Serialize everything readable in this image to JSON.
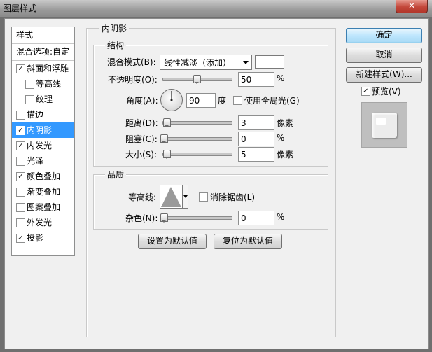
{
  "window": {
    "title": "图层样式",
    "close_glyph": "✕"
  },
  "styles_panel": {
    "header": "样式",
    "blend_options": "混合选项:自定",
    "items": [
      {
        "label": "斜面和浮雕",
        "checked": true,
        "sub": false
      },
      {
        "label": "等高线",
        "checked": false,
        "sub": true
      },
      {
        "label": "纹理",
        "checked": false,
        "sub": true
      },
      {
        "label": "描边",
        "checked": false,
        "sub": false
      },
      {
        "label": "内阴影",
        "checked": true,
        "sub": false,
        "selected": true
      },
      {
        "label": "内发光",
        "checked": true,
        "sub": false
      },
      {
        "label": "光泽",
        "checked": false,
        "sub": false
      },
      {
        "label": "颜色叠加",
        "checked": true,
        "sub": false
      },
      {
        "label": "渐变叠加",
        "checked": false,
        "sub": false
      },
      {
        "label": "图案叠加",
        "checked": false,
        "sub": false
      },
      {
        "label": "外发光",
        "checked": false,
        "sub": false
      },
      {
        "label": "投影",
        "checked": true,
        "sub": false
      }
    ]
  },
  "inner_shadow": {
    "title": "内阴影",
    "structure": {
      "title": "结构",
      "blend_mode_label": "混合模式(B):",
      "blend_mode_value": "线性减淡（添加）",
      "color": "#ffffff",
      "opacity_label": "不透明度(O):",
      "opacity_value": "50",
      "opacity_pct": 50,
      "opacity_unit": "%",
      "angle_label": "角度(A):",
      "angle_value": "90",
      "angle_unit": "度",
      "global_light_label": "使用全局光(G)",
      "global_light_checked": false,
      "distance_label": "距离(D):",
      "distance_value": "3",
      "distance_unit": "像素",
      "choke_label": "阻塞(C):",
      "choke_value": "0",
      "choke_unit": "%",
      "size_label": "大小(S):",
      "size_value": "5",
      "size_unit": "像素"
    },
    "quality": {
      "title": "品质",
      "contour_label": "等高线:",
      "anti_alias_label": "消除锯齿(L)",
      "anti_alias_checked": false,
      "noise_label": "杂色(N):",
      "noise_value": "0",
      "noise_unit": "%"
    },
    "make_default": "设置为默认值",
    "reset_default": "复位为默认值"
  },
  "buttons": {
    "ok": "确定",
    "cancel": "取消",
    "new_style": "新建样式(W)..."
  },
  "preview": {
    "label": "预览(V)",
    "checked": true
  },
  "colors": {
    "selection": "#3399ff",
    "dialog_bg": "#f0f0f0"
  }
}
